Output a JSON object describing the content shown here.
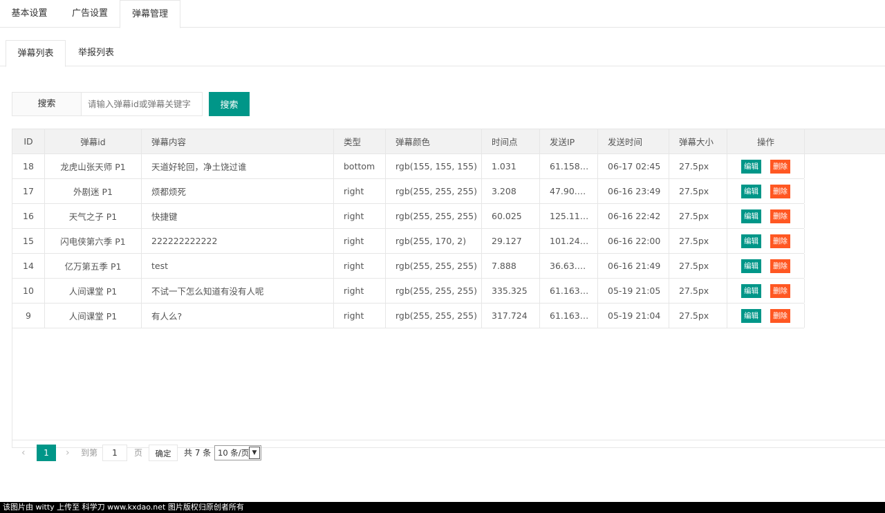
{
  "top_tabs": [
    {
      "label": "基本设置",
      "active": false
    },
    {
      "label": "广告设置",
      "active": false
    },
    {
      "label": "弹幕管理",
      "active": true
    }
  ],
  "sub_tabs": [
    {
      "label": "弹幕列表",
      "active": true
    },
    {
      "label": "举报列表",
      "active": false
    }
  ],
  "search": {
    "label": "搜索",
    "placeholder": "请输入弹幕id或弹幕关键字",
    "value": "",
    "button_label": "搜索"
  },
  "table": {
    "headers": [
      "ID",
      "弹幕id",
      "弹幕内容",
      "类型",
      "弹幕颜色",
      "时间点",
      "发送IP",
      "发送时间",
      "弹幕大小",
      "操作"
    ],
    "rows": [
      {
        "id": "18",
        "danmu_id": "龙虎山张天师 P1",
        "content": "天道好轮回，净土饶过谁",
        "type": "bottom",
        "color": "rgb(155, 155, 155)",
        "time": "1.031",
        "ip": "61.158…",
        "sent": "06-17 02:45",
        "size": "27.5px"
      },
      {
        "id": "17",
        "danmu_id": "外剧迷 P1",
        "content": "烦都烦死",
        "type": "right",
        "color": "rgb(255, 255, 255)",
        "time": "3.208",
        "ip": "47.90.…",
        "sent": "06-16 23:49",
        "size": "27.5px"
      },
      {
        "id": "16",
        "danmu_id": "天气之子 P1",
        "content": "快捷键",
        "type": "right",
        "color": "rgb(255, 255, 255)",
        "time": "60.025",
        "ip": "125.11…",
        "sent": "06-16 22:42",
        "size": "27.5px"
      },
      {
        "id": "15",
        "danmu_id": "闪电侠第六季 P1",
        "content": "222222222222",
        "type": "right",
        "color": "rgb(255, 170, 2)",
        "time": "29.127",
        "ip": "101.24…",
        "sent": "06-16 22:00",
        "size": "27.5px"
      },
      {
        "id": "14",
        "danmu_id": "亿万第五季 P1",
        "content": "test",
        "type": "right",
        "color": "rgb(255, 255, 255)",
        "time": "7.888",
        "ip": "36.63.…",
        "sent": "06-16 21:49",
        "size": "27.5px"
      },
      {
        "id": "10",
        "danmu_id": "人间课堂 P1",
        "content": "不试一下怎么知道有没有人呢",
        "type": "right",
        "color": "rgb(255, 255, 255)",
        "time": "335.325",
        "ip": "61.163…",
        "sent": "05-19 21:05",
        "size": "27.5px"
      },
      {
        "id": "9",
        "danmu_id": "人间课堂 P1",
        "content": "有人么?",
        "type": "right",
        "color": "rgb(255, 255, 255)",
        "time": "317.724",
        "ip": "61.163…",
        "sent": "05-19 21:04",
        "size": "27.5px"
      }
    ],
    "edit_label": "编辑",
    "delete_label": "删除"
  },
  "pager": {
    "prev_icon": "chevron-left-icon",
    "next_icon": "chevron-right-icon",
    "current_page": "1",
    "goto_label": "到第",
    "goto_value": "1",
    "page_unit": "页",
    "confirm_label": "确定",
    "total_label": "共 7 条",
    "per_page_label": "10 条/页"
  },
  "footer": {
    "text": "该图片由 witty 上传至 科学刀 www.kxdao.net 图片版权归原创者所有"
  },
  "colors": {
    "primary": "#009688",
    "danger": "#ff5722",
    "border": "#e6e6e6",
    "header_bg": "#f2f2f2"
  }
}
